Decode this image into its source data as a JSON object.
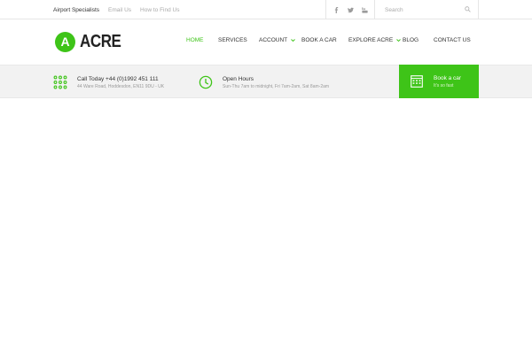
{
  "topbar": {
    "links": [
      "Airport Specialists",
      "Email Us",
      "How to Find Us"
    ],
    "social_icons": [
      "facebook-icon",
      "twitter-icon",
      "youtube-icon"
    ],
    "search_placeholder": "Search"
  },
  "header": {
    "logo_letter": "A",
    "logo_text": "ACRE",
    "nav": [
      {
        "label": "HOME",
        "active": true,
        "dropdown": false
      },
      {
        "label": "SERVICES",
        "active": false,
        "dropdown": false
      },
      {
        "label": "ACCOUNT",
        "active": false,
        "dropdown": true
      },
      {
        "label": "BOOK A CAR",
        "active": false,
        "dropdown": false
      },
      {
        "label": "EXPLORE ACRE",
        "active": false,
        "dropdown": true
      },
      {
        "label": "BLOG",
        "active": false,
        "dropdown": false
      },
      {
        "label": "CONTACT US",
        "active": false,
        "dropdown": false
      }
    ]
  },
  "infobar": {
    "call": {
      "title": "Call Today +44 (0)1992 451 111",
      "sub": "44 Ware Road, Hoddesdon, EN11 9DU - UK"
    },
    "hours": {
      "title": "Open Hours",
      "sub": "Sun-Thu 7am to midnight, Fri 7am-2am, Sat 8am-2am"
    },
    "cta": {
      "title": "Book a car",
      "sub": "It's so fast"
    }
  },
  "colors": {
    "accent": "#3ec418",
    "infobar_bg": "#f2f2f2",
    "text": "#333333",
    "muted": "#aaaaaa"
  }
}
